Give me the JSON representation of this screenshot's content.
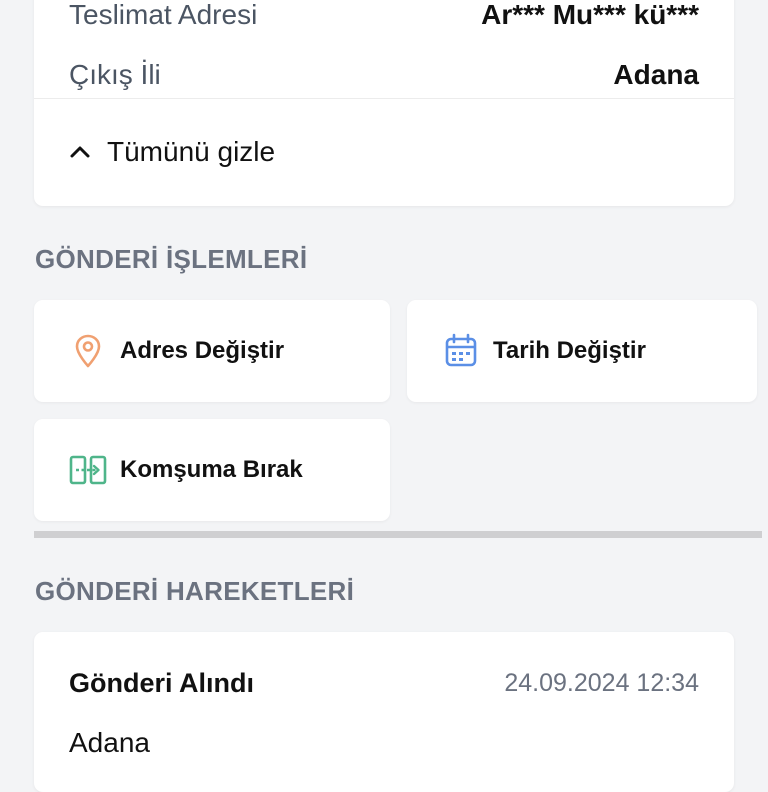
{
  "details": {
    "rows": [
      {
        "label": "Teslimat Adresi",
        "value": "Ar*** Mu*** kü***"
      },
      {
        "label": "Çıkış İli",
        "value": "Adana"
      }
    ],
    "toggle_label": "Tümünü gizle"
  },
  "actions_section": {
    "title": "GÖNDERİ İŞLEMLERİ",
    "items": [
      {
        "label": "Adres Değiştir",
        "icon": "location-pin-icon",
        "color": "#f0a071"
      },
      {
        "label": "Tarih Değiştir",
        "icon": "calendar-icon",
        "color": "#5b8fe6"
      },
      {
        "label": "Komşuma Bırak",
        "icon": "neighbor-transfer-icon",
        "color": "#4fb58a"
      }
    ]
  },
  "history_section": {
    "title": "GÖNDERİ HAREKETLERİ",
    "events": [
      {
        "title": "Gönderi Alındı",
        "time": "24.09.2024 12:34",
        "location": "Adana"
      }
    ]
  },
  "colors": {
    "background": "#f3f4f6",
    "card": "#ffffff",
    "section_title": "#6b7280",
    "separator": "#cfcfd1"
  }
}
